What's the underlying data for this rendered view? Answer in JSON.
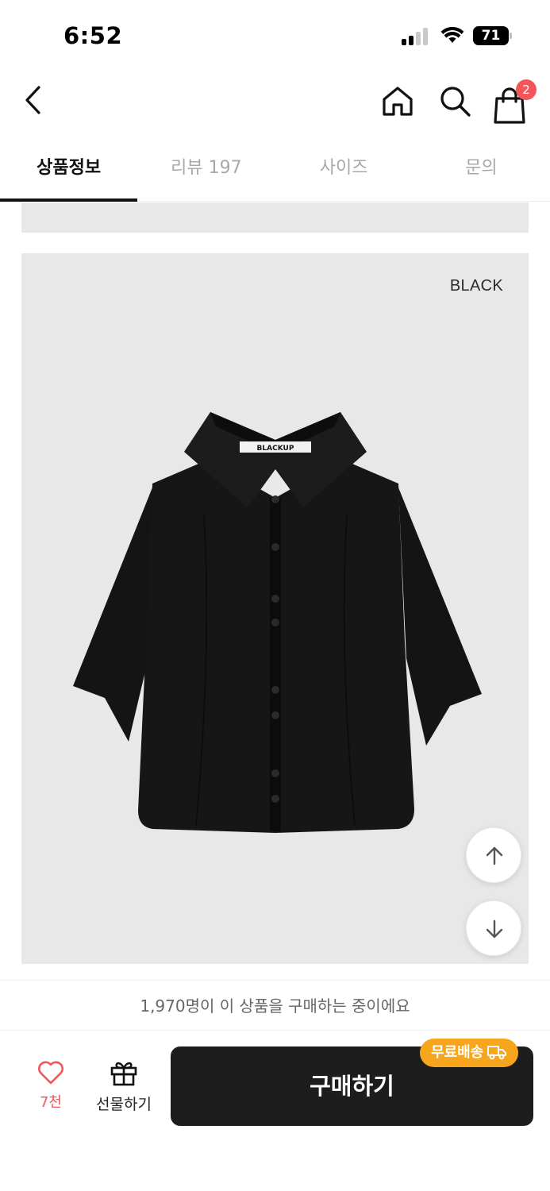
{
  "status_bar": {
    "time": "6:52",
    "battery_level": "71",
    "signal_bars": 2,
    "signal_bars_total": 4,
    "icons": [
      "cellular-signal-icon",
      "wifi-icon",
      "battery-icon"
    ]
  },
  "header": {
    "icons": [
      "back-arrow-icon",
      "home-icon",
      "search-icon",
      "shopping-bag-icon"
    ],
    "cart_count": "2"
  },
  "tabs": [
    {
      "label": "상품정보",
      "active": true
    },
    {
      "label": "리뷰 197",
      "active": false
    },
    {
      "label": "사이즈",
      "active": false
    },
    {
      "label": "문의",
      "active": false
    }
  ],
  "product_image": {
    "color_label": "BLACK",
    "brand_tag": "BLACKUP",
    "shirt_color": "#121212"
  },
  "scroll_buttons": {
    "icons": [
      "arrow-up-icon",
      "arrow-down-icon"
    ]
  },
  "bottom_notice": "1,970명이 이 상품을 구매하는 중이에요",
  "bottom_bar": {
    "like_count": "7천",
    "gift_label": "선물하기",
    "buy_label": "구매하기",
    "free_shipping_badge": "무료배송",
    "icons": [
      "heart-icon",
      "gift-icon",
      "truck-icon"
    ]
  },
  "colors": {
    "accent_red": "#f2555a",
    "badge_orange": "#f7a51c",
    "buy_button_bg": "#1d1d1d",
    "image_bg": "#e8e8e8"
  }
}
